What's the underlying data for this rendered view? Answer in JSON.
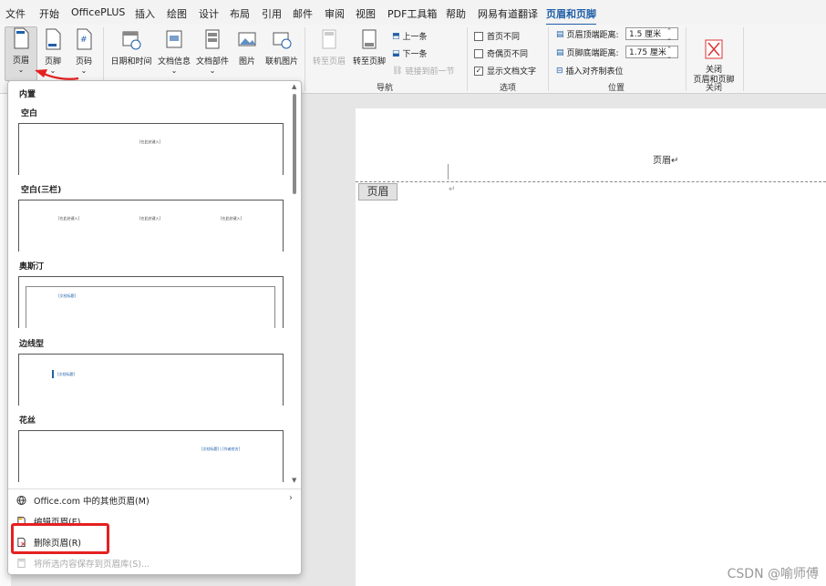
{
  "tabs": [
    "文件",
    "开始",
    "OfficePLUS",
    "插入",
    "绘图",
    "设计",
    "布局",
    "引用",
    "邮件",
    "审阅",
    "视图",
    "PDF工具箱",
    "帮助",
    "网易有道翻译",
    "页眉和页脚"
  ],
  "ribbon": {
    "header_label": "页眉",
    "footer_label": "页脚",
    "pagenum_label": "页码",
    "datetime_label": "日期和时间",
    "docinfo_label": "文档信息",
    "docparts_label": "文档部件",
    "picture_label": "图片",
    "online_pic_label": "联机图片",
    "goto_header_label": "转至页眉",
    "goto_footer_label": "转至页脚",
    "prev_label": "上一条",
    "next_label": "下一条",
    "link_prev_label": "链接到前一节",
    "nav_group_label": "导航",
    "first_page_diff": "首页不同",
    "odd_even_diff": "奇偶页不同",
    "show_doc_text": "显示文档文字",
    "options_group_label": "选项",
    "header_top_label": "页眉顶端距离:",
    "header_top_value": "1.5 厘米",
    "footer_bottom_label": "页脚底端距离:",
    "footer_bottom_value": "1.75 厘米",
    "insert_align_tab": "插入对齐制表位",
    "position_group_label": "位置",
    "close_label": "关闭\n页眉和页脚",
    "close_group_label": "关闭"
  },
  "dropdown": {
    "section": "内置",
    "items": [
      {
        "title": "空白",
        "placeholders": [
          "[在此处键入]"
        ]
      },
      {
        "title": "空白(三栏)",
        "placeholders": [
          "[在此处键入]",
          "[在此处键入]",
          "[在此处键入]"
        ]
      },
      {
        "title": "奥斯汀",
        "placeholders": [
          "[文档标题]"
        ]
      },
      {
        "title": "边线型",
        "placeholders": [
          "[文档标题]"
        ]
      },
      {
        "title": "花丝",
        "placeholders": [
          "[文档标题] | [作者姓名]"
        ]
      }
    ],
    "menu": [
      {
        "label": "Office.com 中的其他页眉(M)",
        "disabled": false
      },
      {
        "label": "编辑页眉(E)",
        "disabled": false
      },
      {
        "label": "删除页眉(R)",
        "disabled": false
      },
      {
        "label": "将所选内容保存到页眉库(S)...",
        "disabled": true
      }
    ]
  },
  "document": {
    "header_text": "页眉↵",
    "header_tag": "页眉",
    "para_mark": "↵"
  },
  "watermark": "CSDN @喻师傅",
  "colors": {
    "accent": "#1f5fa8",
    "highlight": "#e52020"
  }
}
